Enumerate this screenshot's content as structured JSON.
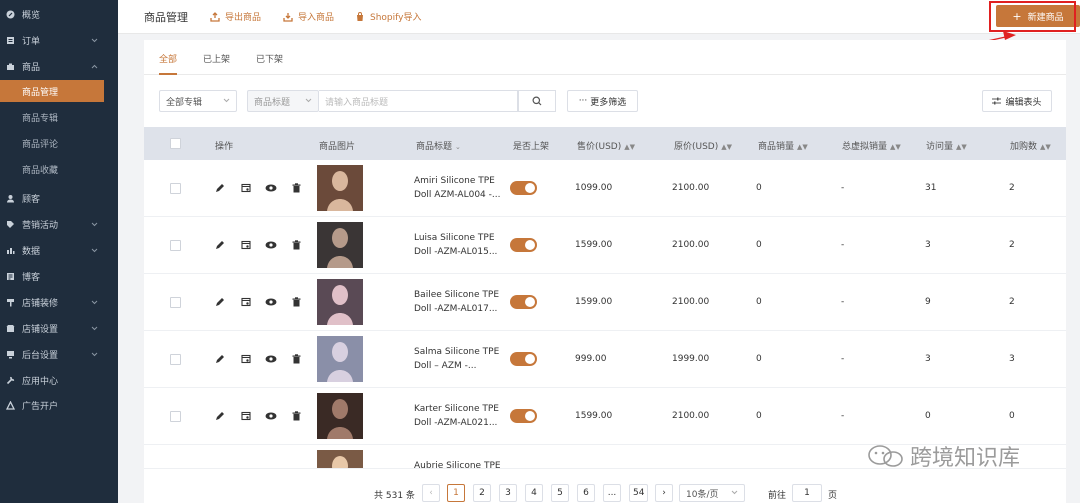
{
  "sidebar": {
    "items": [
      {
        "label": "概览",
        "icon": "dashboard-icon"
      },
      {
        "label": "订单",
        "icon": "order-icon",
        "expandable": true
      },
      {
        "label": "商品",
        "icon": "product-icon",
        "expandable": true,
        "expanded": true
      },
      {
        "label": "顾客",
        "icon": "customer-icon"
      },
      {
        "label": "营销活动",
        "icon": "tag-icon",
        "expandable": true
      },
      {
        "label": "数据",
        "icon": "chart-icon",
        "expandable": true
      },
      {
        "label": "博客",
        "icon": "blog-icon"
      },
      {
        "label": "店铺装修",
        "icon": "paint-icon",
        "expandable": true
      },
      {
        "label": "店铺设置",
        "icon": "store-settings-icon",
        "expandable": true
      },
      {
        "label": "后台设置",
        "icon": "admin-settings-icon",
        "expandable": true
      },
      {
        "label": "应用中心",
        "icon": "wrench-icon"
      },
      {
        "label": "广告开户",
        "icon": "ads-icon"
      }
    ],
    "sub_items": [
      "商品管理",
      "商品专辑",
      "商品评论",
      "商品收藏"
    ],
    "active_sub": "商品管理"
  },
  "header": {
    "title": "商品管理",
    "export_label": "导出商品",
    "import_label": "导入商品",
    "shopify_label": "Shopify导入",
    "new_label": "新建商品"
  },
  "tabs": [
    "全部",
    "已上架",
    "已下架"
  ],
  "filters": {
    "collection": "全部专辑",
    "field": "商品标题",
    "search_placeholder": "请输入商品标题",
    "more_filters": "更多筛选",
    "edit_columns": "编辑表头"
  },
  "table": {
    "columns": [
      "操作",
      "商品图片",
      "商品标题",
      "是否上架",
      "售价(USD)",
      "原价(USD)",
      "商品销量",
      "总虚拟销量",
      "访问量",
      "加购数"
    ],
    "rows": [
      {
        "title_l1": "Amiri Silicone TPE",
        "title_l2": "Doll AZM-AL004 -...",
        "price": "1099.00",
        "original": "2100.00",
        "sales": "0",
        "virtual": "-",
        "visits": "31",
        "cart": "2"
      },
      {
        "title_l1": "Luisa Silicone TPE",
        "title_l2": "Doll -AZM-AL015...",
        "price": "1599.00",
        "original": "2100.00",
        "sales": "0",
        "virtual": "-",
        "visits": "3",
        "cart": "2"
      },
      {
        "title_l1": "Bailee Silicone TPE",
        "title_l2": "Doll -AZM-AL017...",
        "price": "1599.00",
        "original": "2100.00",
        "sales": "0",
        "virtual": "-",
        "visits": "9",
        "cart": "2"
      },
      {
        "title_l1": "Salma Silicone TPE",
        "title_l2": "Doll – AZM -...",
        "price": "999.00",
        "original": "1999.00",
        "sales": "0",
        "virtual": "-",
        "visits": "3",
        "cart": "3"
      },
      {
        "title_l1": "Karter Silicone TPE",
        "title_l2": "Doll -AZM-AL021...",
        "price": "1599.00",
        "original": "2100.00",
        "sales": "0",
        "virtual": "-",
        "visits": "0",
        "cart": "0"
      },
      {
        "title_l1": "Aubrie Silicone TPE",
        "title_l2": "",
        "price": "",
        "original": "",
        "sales": "",
        "virtual": "",
        "visits": "",
        "cart": ""
      }
    ]
  },
  "pagination": {
    "total": "共 531 条",
    "pages": [
      "1",
      "2",
      "3",
      "4",
      "5",
      "6",
      "...",
      "54"
    ],
    "current": "1",
    "page_size": "10条/页",
    "goto_prefix": "前往",
    "goto_value": "1",
    "goto_suffix": "页"
  },
  "watermark": "跨境知识库",
  "colors": {
    "accent": "#c6773a",
    "sidebar_bg": "#1f2d3d",
    "highlight": "#e02020"
  }
}
